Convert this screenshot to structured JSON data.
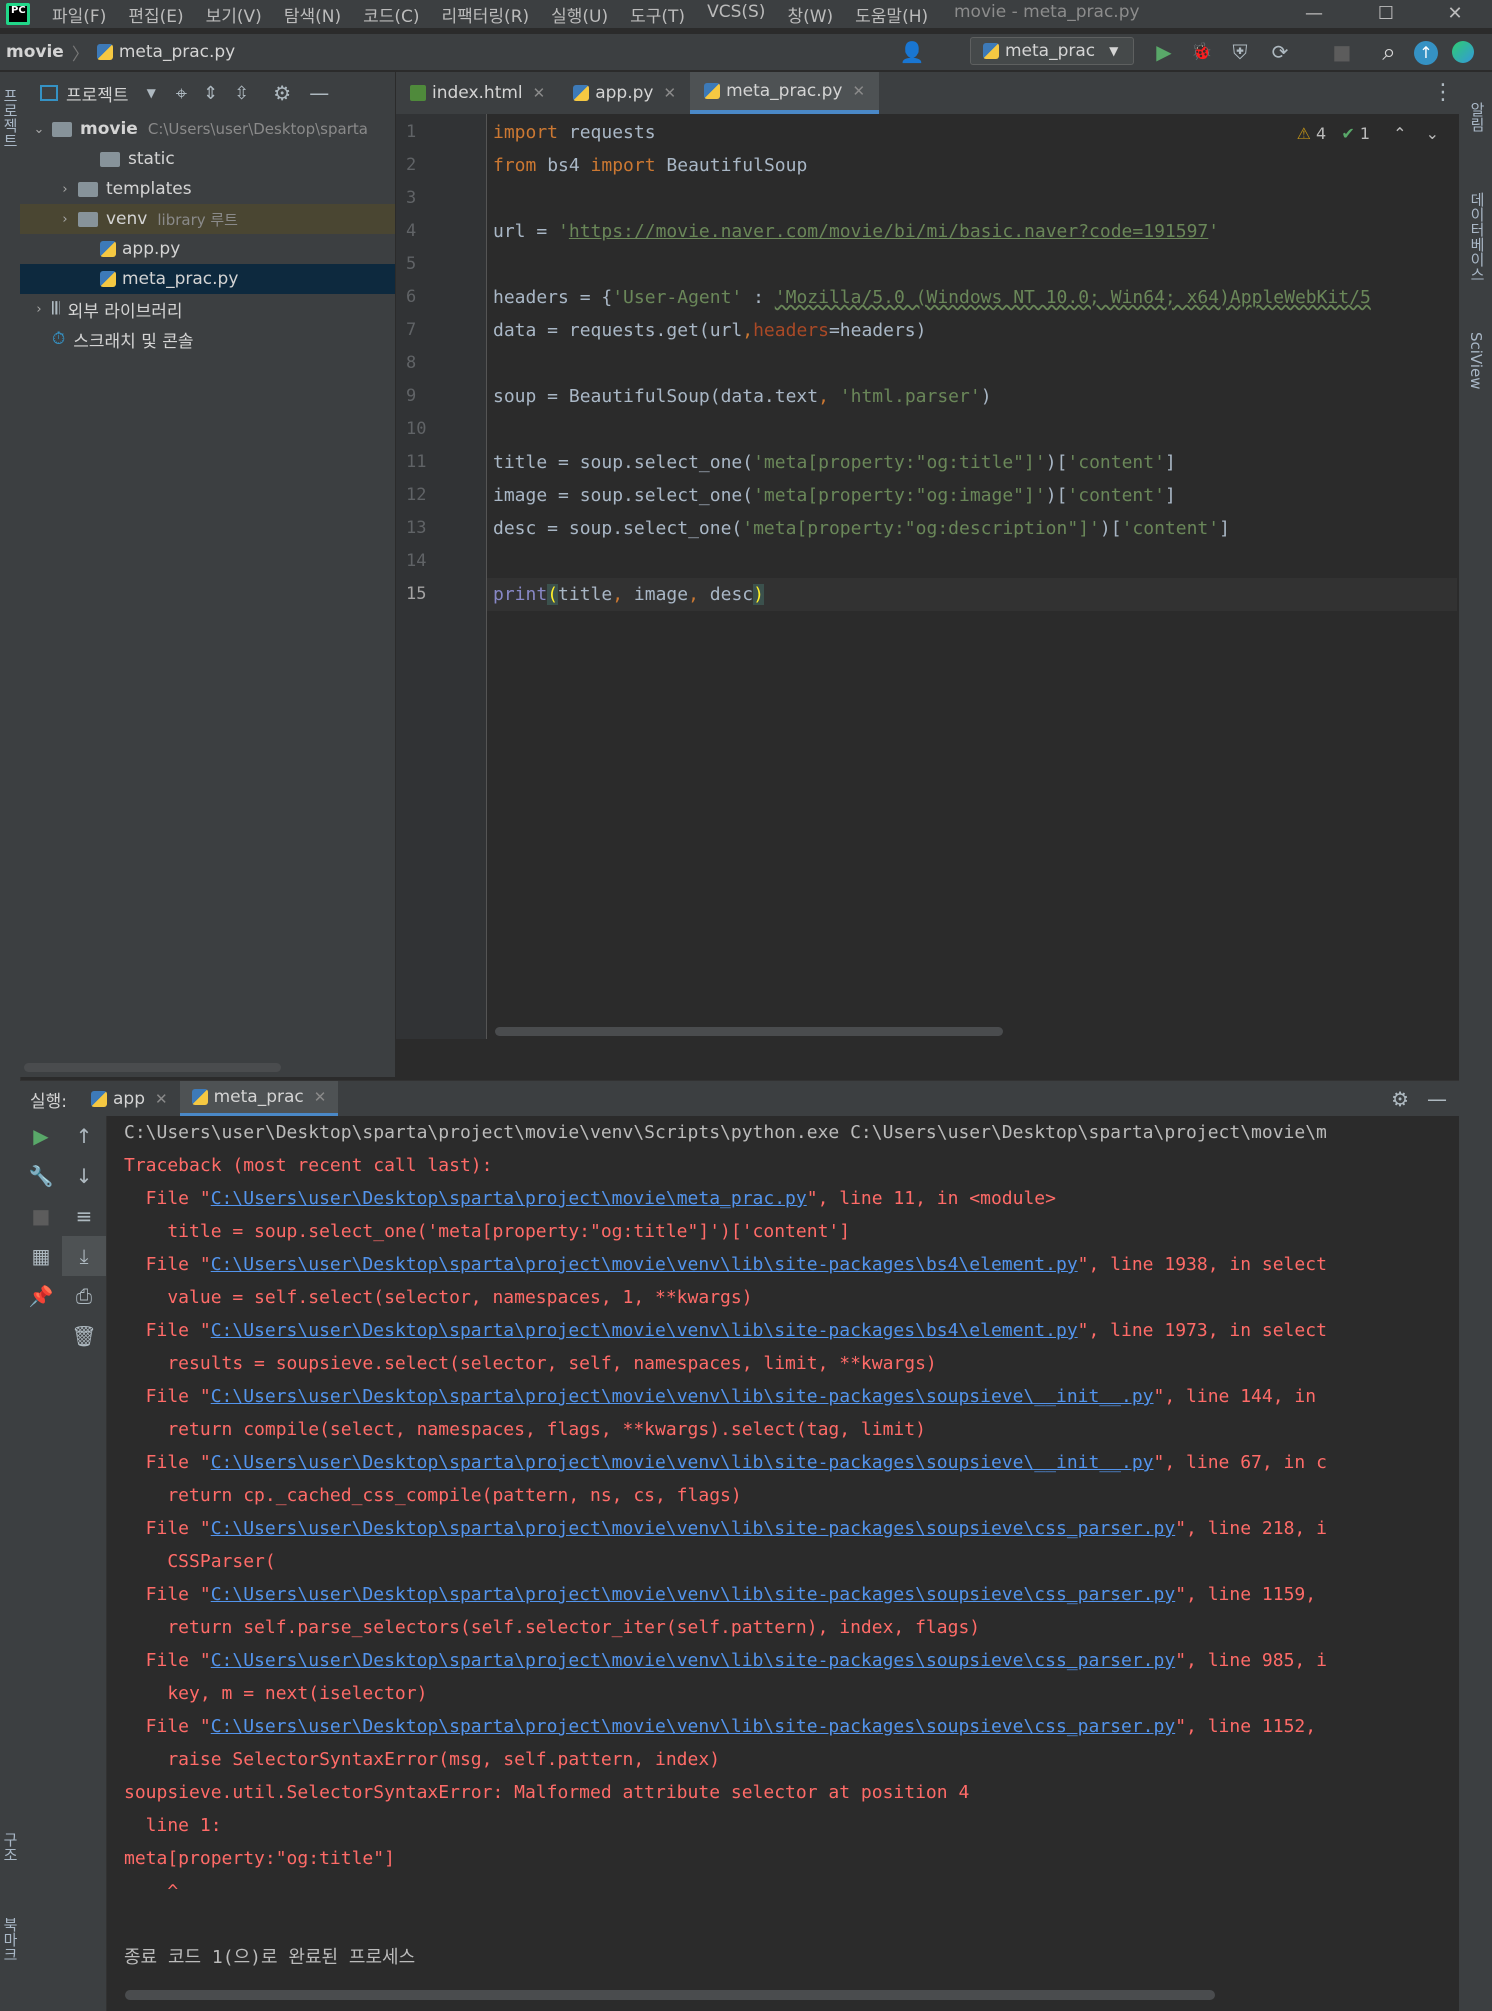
{
  "menubar": {
    "logo": "PC",
    "items": [
      "파일(F)",
      "편집(E)",
      "보기(V)",
      "탐색(N)",
      "코드(C)",
      "리팩터링(R)",
      "실행(U)",
      "도구(T)",
      "VCS(S)",
      "창(W)",
      "도움말(H)"
    ],
    "window_title": "movie - meta_prac.py",
    "minimize": "—",
    "maximize": "☐",
    "close": "✕"
  },
  "navbar": {
    "project": "movie",
    "file": "meta_prac.py",
    "run_config": "meta_prac",
    "user_icon": "👤",
    "run_icon": "▶",
    "debug_icon": "🐞",
    "coverage_icon": "⛨",
    "profile_icon": "⟳",
    "stop_icon": "■",
    "search_icon": "⌕",
    "update_icon": "↑"
  },
  "project_panel": {
    "title": "프로젝트",
    "tree": [
      {
        "label": "movie",
        "hint": "C:\\Users\\user\\Desktop\\sparta",
        "type": "root",
        "expanded": true
      },
      {
        "label": "static",
        "type": "folder"
      },
      {
        "label": "templates",
        "type": "folder"
      },
      {
        "label": "venv",
        "hint": "library 루트",
        "type": "folder"
      },
      {
        "label": "app.py",
        "type": "py"
      },
      {
        "label": "meta_prac.py",
        "type": "py",
        "selected": true
      },
      {
        "label": "외부 라이브러리",
        "type": "lib"
      },
      {
        "label": "스크래치 및 콘솔",
        "type": "scratch"
      }
    ]
  },
  "editor": {
    "tabs": [
      {
        "label": "index.html",
        "type": "html"
      },
      {
        "label": "app.py",
        "type": "py"
      },
      {
        "label": "meta_prac.py",
        "type": "py",
        "active": true
      }
    ],
    "inspections": {
      "warnings": "4",
      "ok": "1"
    },
    "line_numbers": [
      "1",
      "2",
      "3",
      "4",
      "5",
      "6",
      "7",
      "8",
      "9",
      "10",
      "11",
      "12",
      "13",
      "14",
      "15"
    ]
  },
  "run_panel": {
    "label": "실행:",
    "tabs": [
      "app",
      "meta_prac"
    ],
    "console_lines": [
      {
        "kind": "normal",
        "text": "C:\\Users\\user\\Desktop\\sparta\\project\\movie\\venv\\Scripts\\python.exe C:\\Users\\user\\Desktop\\sparta\\project\\movie\\m"
      },
      {
        "kind": "err",
        "text": "Traceback (most recent call last):"
      },
      {
        "kind": "file",
        "pre": "  File \"",
        "link": "C:\\Users\\user\\Desktop\\sparta\\project\\movie\\meta_prac.py",
        "post": "\", line 11, in <module>"
      },
      {
        "kind": "err",
        "text": "    title = soup.select_one('meta[property:\"og:title\"]')['content']"
      },
      {
        "kind": "file",
        "pre": "  File \"",
        "link": "C:\\Users\\user\\Desktop\\sparta\\project\\movie\\venv\\lib\\site-packages\\bs4\\element.py",
        "post": "\", line 1938, in select"
      },
      {
        "kind": "err",
        "text": "    value = self.select(selector, namespaces, 1, **kwargs)"
      },
      {
        "kind": "file",
        "pre": "  File \"",
        "link": "C:\\Users\\user\\Desktop\\sparta\\project\\movie\\venv\\lib\\site-packages\\bs4\\element.py",
        "post": "\", line 1973, in select"
      },
      {
        "kind": "err",
        "text": "    results = soupsieve.select(selector, self, namespaces, limit, **kwargs)"
      },
      {
        "kind": "file",
        "pre": "  File \"",
        "link": "C:\\Users\\user\\Desktop\\sparta\\project\\movie\\venv\\lib\\site-packages\\soupsieve\\__init__.py",
        "post": "\", line 144, in"
      },
      {
        "kind": "err",
        "text": "    return compile(select, namespaces, flags, **kwargs).select(tag, limit)"
      },
      {
        "kind": "file",
        "pre": "  File \"",
        "link": "C:\\Users\\user\\Desktop\\sparta\\project\\movie\\venv\\lib\\site-packages\\soupsieve\\__init__.py",
        "post": "\", line 67, in c"
      },
      {
        "kind": "err",
        "text": "    return cp._cached_css_compile(pattern, ns, cs, flags)"
      },
      {
        "kind": "file",
        "pre": "  File \"",
        "link": "C:\\Users\\user\\Desktop\\sparta\\project\\movie\\venv\\lib\\site-packages\\soupsieve\\css_parser.py",
        "post": "\", line 218, i"
      },
      {
        "kind": "err",
        "text": "    CSSParser("
      },
      {
        "kind": "file",
        "pre": "  File \"",
        "link": "C:\\Users\\user\\Desktop\\sparta\\project\\movie\\venv\\lib\\site-packages\\soupsieve\\css_parser.py",
        "post": "\", line 1159,"
      },
      {
        "kind": "err",
        "text": "    return self.parse_selectors(self.selector_iter(self.pattern), index, flags)"
      },
      {
        "kind": "file",
        "pre": "  File \"",
        "link": "C:\\Users\\user\\Desktop\\sparta\\project\\movie\\venv\\lib\\site-packages\\soupsieve\\css_parser.py",
        "post": "\", line 985, i"
      },
      {
        "kind": "err",
        "text": "    key, m = next(iselector)"
      },
      {
        "kind": "file",
        "pre": "  File \"",
        "link": "C:\\Users\\user\\Desktop\\sparta\\project\\movie\\venv\\lib\\site-packages\\soupsieve\\css_parser.py",
        "post": "\", line 1152,"
      },
      {
        "kind": "err",
        "text": "    raise SelectorSyntaxError(msg, self.pattern, index)"
      },
      {
        "kind": "err",
        "text": "soupsieve.util.SelectorSyntaxError: Malformed attribute selector at position 4"
      },
      {
        "kind": "err",
        "text": "  line 1:"
      },
      {
        "kind": "err",
        "text": "meta[property:\"og:title\"]"
      },
      {
        "kind": "err",
        "text": "    ^"
      },
      {
        "kind": "normal",
        "text": ""
      },
      {
        "kind": "normal",
        "text": "종료 코드 1(으)로 완료된 프로세스"
      }
    ]
  },
  "right_stripe": {
    "notifications": "알림",
    "database": "데이터베이스",
    "sciview": "SciView"
  },
  "left_stripe": {
    "project": "프로젝트",
    "structure": "구조",
    "bookmarks": "북마크"
  },
  "colors": {
    "keyword": "#cc7832",
    "string": "#6a8759",
    "error": "#ff6b68",
    "link": "#5394ec",
    "accent": "#4a88c7"
  }
}
